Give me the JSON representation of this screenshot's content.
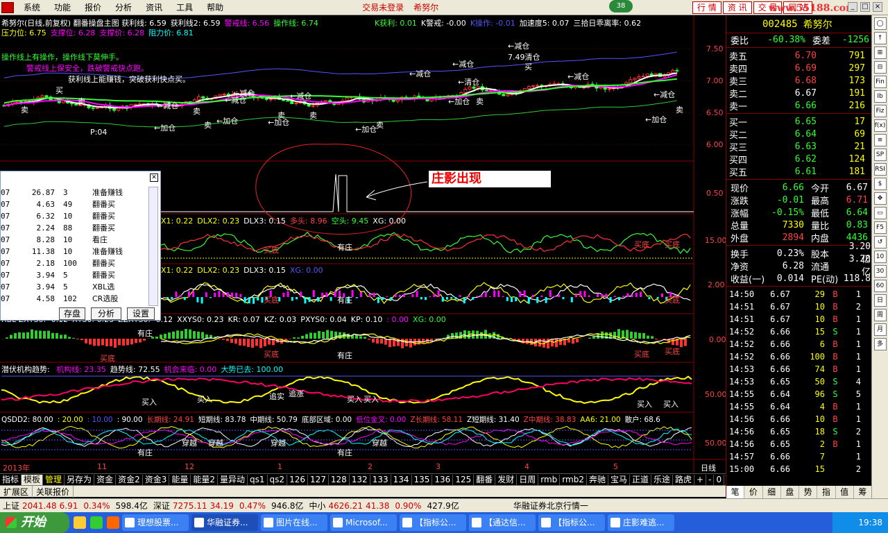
{
  "menu": {
    "items": [
      "系统",
      "功能",
      "报价",
      "分析",
      "资讯",
      "工具",
      "帮助"
    ],
    "status": "交易未登录",
    "stock_name": "希努尔",
    "badge": "38",
    "top_tabs": [
      "行 情",
      "资 讯",
      "交 易",
      "网 站"
    ],
    "site_mark": "www.55188.com",
    "window_buttons": [
      "_",
      "□",
      "×"
    ]
  },
  "chart": {
    "header_line1": {
      "prefix": "希努尔(日线,前复权) 翻番操盘主图",
      "items": [
        {
          "label": "获利线",
          "value": "6.59",
          "color": "#fff"
        },
        {
          "label": "获利线2",
          "value": "6.59",
          "color": "#fff"
        },
        {
          "label": "警戒线",
          "value": "6.56",
          "color": "#f0f"
        },
        {
          "label": "操作线",
          "value": "6.74",
          "color": "#3f3"
        }
      ],
      "right_items": [
        {
          "label": "K获利",
          "value": "0.01",
          "color": "#3f3"
        },
        {
          "label": "K警戒",
          "value": "-0.00",
          "color": "#fff"
        },
        {
          "label": "K操作",
          "value": "-0.01",
          "color": "#55f"
        },
        {
          "label": "加速度5",
          "value": "0.07",
          "color": "#fff"
        },
        {
          "label": "三拾日乖离率",
          "value": "0.62",
          "color": "#fff"
        }
      ]
    },
    "header_line2": [
      {
        "label": "压力位",
        "value": "6.75",
        "color": "#ff0"
      },
      {
        "label": "支撑位",
        "value": "6.28",
        "color": "#f0f"
      },
      {
        "label": "支撑价",
        "value": "6.28",
        "color": "#f0f"
      },
      {
        "label": "阻力价",
        "value": "6.81",
        "color": "#0ff"
      }
    ],
    "notes": [
      {
        "text": "操作线上有操作，操作线下莫伸手。",
        "color": "#3f3"
      },
      {
        "text": "警戒线上保安全，跌破警戒快点跑。",
        "color": "#f0f"
      },
      {
        "text": "获利线上能赚钱，突破获利快点买。",
        "color": "#fff"
      }
    ],
    "price_axis": [
      "7.50",
      "7.00",
      "6.50",
      "6.00"
    ],
    "price_labels": [
      "7.49清仓",
      "P:04"
    ],
    "annotation": "庄影出现",
    "panel2_axis": "0.50",
    "panel3": {
      "items": [
        {
          "label": "X1",
          "value": "0.22",
          "color": "#ff0"
        },
        {
          "label": "DLX2",
          "value": "0.23",
          "color": "#ff0"
        },
        {
          "label": "DLX3",
          "value": "0.15",
          "color": "#fff"
        },
        {
          "label": "多头",
          "value": "8.96",
          "color": "#f44"
        },
        {
          "label": "空头",
          "value": "9.45",
          "color": "#3f3"
        },
        {
          "label": "XG",
          "value": "0.00",
          "color": "#fff"
        }
      ],
      "axis": "15.00"
    },
    "panel4": {
      "items": [
        {
          "label": "X1",
          "value": "0.22",
          "color": "#ff0"
        },
        {
          "label": "DLX2",
          "value": "0.23",
          "color": "#ff0"
        },
        {
          "label": "DLX3",
          "value": "0.15",
          "color": "#fff"
        },
        {
          "label": "XG",
          "value": "0.00",
          "color": "#55f"
        }
      ],
      "axis": "2.00"
    },
    "panel5": {
      "items": [
        {
          "label": "XBL ZXYS0",
          "value": "-0.12",
          "color": "#fff"
        },
        {
          "label": "XYS0",
          "value": "0.23",
          "color": "#fff"
        },
        {
          "label": "ZZXYS0",
          "value": "-0.12",
          "color": "#fff"
        },
        {
          "label": "XXYS0",
          "value": "0.23",
          "color": "#fff"
        },
        {
          "label": "KR",
          "value": "0.07",
          "color": "#fff"
        },
        {
          "label": "KZ",
          "value": "0.03",
          "color": "#fff"
        },
        {
          "label": "PXYS0",
          "value": "0.04",
          "color": "#fff"
        },
        {
          "label": "KP",
          "value": "0.10",
          "color": "#fff"
        },
        {
          "label": "",
          "value": "0.00",
          "color": "#f0f"
        },
        {
          "label": "XG",
          "value": "0.00",
          "color": "#3f3"
        }
      ],
      "axis": "0.00"
    },
    "panel6": {
      "items": [
        {
          "label": "潜伏机构趋势",
          "value": "",
          "color": "#fff"
        },
        {
          "label": "机构线",
          "value": "23.35",
          "color": "#f0f"
        },
        {
          "label": "趋势线",
          "value": "72.55",
          "color": "#fff"
        },
        {
          "label": "机会来临",
          "value": "0.00",
          "color": "#f0f"
        },
        {
          "label": "大势已去",
          "value": "100.00",
          "color": "#0ff"
        }
      ],
      "axis": "50.00"
    },
    "panel7": {
      "items": [
        {
          "label": "QSDD2",
          "value": "80.00",
          "color": "#fff"
        },
        {
          "label": "",
          "value": "20.00",
          "color": "#ff0"
        },
        {
          "label": "",
          "value": "10.00",
          "color": "#55f"
        },
        {
          "label": "",
          "value": "90.00",
          "color": "#fff"
        },
        {
          "label": "长期线",
          "value": "24.91",
          "color": "#f44"
        },
        {
          "label": "短期线",
          "value": "83.78",
          "color": "#fff"
        },
        {
          "label": "中期线",
          "value": "50.79",
          "color": "#fff"
        },
        {
          "label": "底部区域",
          "value": "0.00",
          "color": "#fff"
        },
        {
          "label": "低位金叉",
          "value": "0.00",
          "color": "#f0f"
        },
        {
          "label": "Z长期线",
          "value": "58.11",
          "color": "#f44"
        },
        {
          "label": "Z短期线",
          "value": "31.40",
          "color": "#fff"
        },
        {
          "label": "Z中期线",
          "value": "38.83",
          "color": "#f44"
        },
        {
          "label": "AA6",
          "value": "21.00",
          "color": "#ff0"
        },
        {
          "label": "散户",
          "value": "68.6",
          "color": "#fff"
        }
      ],
      "axis": "50.00"
    },
    "date_axis": [
      "2013年",
      "11",
      "12",
      "1",
      "2",
      "3",
      "4",
      "5"
    ],
    "period_label": "日线",
    "signals": {
      "buy": "买",
      "sell": "卖",
      "reduce": "←减仓",
      "add": "←加仓",
      "clear": "←清仓",
      "have_zhuang": "有庄",
      "buy_dip": "买底",
      "buy_in": "买入",
      "trap": "追实",
      "chase": "追涨",
      "cross": "穿越"
    }
  },
  "popup": {
    "rows": [
      {
        "a": "07",
        "b": "26.87",
        "c": "3",
        "d": "准备赚钱"
      },
      {
        "a": "07",
        "b": "4.63",
        "c": "49",
        "d": "翻番买"
      },
      {
        "a": "07",
        "b": "6.32",
        "c": "10",
        "d": "翻番买"
      },
      {
        "a": "07",
        "b": "2.24",
        "c": "88",
        "d": "翻番买"
      },
      {
        "a": "07",
        "b": "8.28",
        "c": "10",
        "d": "看庄"
      },
      {
        "a": "07",
        "b": "11.38",
        "c": "10",
        "d": "准备赚钱"
      },
      {
        "a": "07",
        "b": "2.18",
        "c": "100",
        "d": "翻番买"
      },
      {
        "a": "07",
        "b": "3.94",
        "c": "5",
        "d": "翻番买"
      },
      {
        "a": "07",
        "b": "3.94",
        "c": "5",
        "d": "XBL选"
      },
      {
        "a": "07",
        "b": "4.58",
        "c": "102",
        "d": "CR选股"
      }
    ],
    "buttons": [
      "存盘",
      "分析",
      "设置"
    ]
  },
  "quote": {
    "code": "002485",
    "name": "希努尔",
    "wb": {
      "label": "委比",
      "value": "-60.38%",
      "label2": "委差",
      "value2": "-1256"
    },
    "asks": [
      {
        "label": "卖五",
        "price": "6.70",
        "vol": "791"
      },
      {
        "label": "卖四",
        "price": "6.69",
        "vol": "297"
      },
      {
        "label": "卖三",
        "price": "6.68",
        "vol": "173"
      },
      {
        "label": "卖二",
        "price": "6.67",
        "vol": "191"
      },
      {
        "label": "卖一",
        "price": "6.66",
        "vol": "216"
      }
    ],
    "bids": [
      {
        "label": "买一",
        "price": "6.65",
        "vol": "17"
      },
      {
        "label": "买二",
        "price": "6.64",
        "vol": "69"
      },
      {
        "label": "买三",
        "price": "6.63",
        "vol": "21"
      },
      {
        "label": "买四",
        "price": "6.62",
        "vol": "124"
      },
      {
        "label": "买五",
        "price": "6.61",
        "vol": "181"
      }
    ],
    "stats": [
      {
        "l1": "现价",
        "v1": "6.66",
        "c1": "#3f3",
        "l2": "今开",
        "v2": "6.67",
        "c2": "#fff"
      },
      {
        "l1": "涨跌",
        "v1": "-0.01",
        "c1": "#3f3",
        "l2": "最高",
        "v2": "6.71",
        "c2": "#f44"
      },
      {
        "l1": "涨幅",
        "v1": "-0.15%",
        "c1": "#3f3",
        "l2": "最低",
        "v2": "6.64",
        "c2": "#3f3"
      },
      {
        "l1": "总量",
        "v1": "7330",
        "c1": "#ff0",
        "l2": "量比",
        "v2": "0.83",
        "c2": "#3f3"
      },
      {
        "l1": "外盘",
        "v1": "2894",
        "c1": "#f44",
        "l2": "内盘",
        "v2": "4436",
        "c2": "#3f3"
      }
    ],
    "stats2": [
      {
        "l1": "换手",
        "v1": "0.23%",
        "l2": "股本",
        "v2": "3.20亿"
      },
      {
        "l1": "净资",
        "v1": "6.28",
        "l2": "流通",
        "v2": "3.20亿"
      },
      {
        "l1": "收益(一)",
        "v1": "0.014",
        "l2": "PE(动)",
        "v2": "118.8"
      }
    ],
    "ticks": [
      {
        "t": "14:50",
        "p": "6.67",
        "v": "29",
        "s": "B",
        "n": "1"
      },
      {
        "t": "14:51",
        "p": "6.67",
        "v": "10",
        "s": "B",
        "n": "2"
      },
      {
        "t": "14:51",
        "p": "6.67",
        "v": "10",
        "s": "B",
        "n": "1"
      },
      {
        "t": "14:52",
        "p": "6.66",
        "v": "15",
        "s": "S",
        "n": "1"
      },
      {
        "t": "14:52",
        "p": "6.66",
        "v": "6",
        "s": "B",
        "n": "1"
      },
      {
        "t": "14:52",
        "p": "6.66",
        "v": "100",
        "s": "B",
        "n": "1"
      },
      {
        "t": "14:53",
        "p": "6.66",
        "v": "74",
        "s": "B",
        "n": "1"
      },
      {
        "t": "14:53",
        "p": "6.65",
        "v": "50",
        "s": "S",
        "n": "4"
      },
      {
        "t": "14:55",
        "p": "6.64",
        "v": "96",
        "s": "S",
        "n": "5"
      },
      {
        "t": "14:55",
        "p": "6.64",
        "v": "4",
        "s": "B",
        "n": "1"
      },
      {
        "t": "14:56",
        "p": "6.66",
        "v": "10",
        "s": "B",
        "n": "1"
      },
      {
        "t": "14:56",
        "p": "6.65",
        "v": "18",
        "s": "S",
        "n": "2"
      },
      {
        "t": "14:56",
        "p": "6.65",
        "v": "2",
        "s": "B",
        "n": "1"
      },
      {
        "t": "14:57",
        "p": "6.66",
        "v": "7",
        "s": "",
        "n": "1"
      },
      {
        "t": "15:00",
        "p": "6.66",
        "v": "15",
        "s": "",
        "n": "2"
      }
    ],
    "bottom_tabs": [
      "笔",
      "价",
      "细",
      "盘",
      "势",
      "指",
      "值",
      "筹"
    ]
  },
  "toolstrip": [
    "◯",
    "↑",
    "⊞",
    "⊟",
    "Fin",
    "Ib",
    "Fiz",
    "f(x)",
    "≡",
    "SP",
    "RSI",
    "$",
    "✥",
    "▭",
    "F5",
    "↺",
    "10",
    "30",
    "60",
    "日",
    "周",
    "月",
    "多"
  ],
  "tabs": [
    {
      "label": "指标",
      "active": false
    },
    {
      "label": "模板",
      "active": true
    },
    {
      "label": "管理",
      "active": false,
      "hl": true
    },
    {
      "label": "另存为",
      "active": false
    },
    {
      "label": "资金",
      "active": false
    },
    {
      "label": "资金2",
      "active": false
    },
    {
      "label": "资金3",
      "active": false
    },
    {
      "label": "能量",
      "active": false
    },
    {
      "label": "能量2",
      "active": false
    },
    {
      "label": "量异动",
      "active": false
    },
    {
      "label": "qs1",
      "active": false
    },
    {
      "label": "qs2",
      "active": false
    },
    {
      "label": "126",
      "active": false
    },
    {
      "label": "127",
      "active": false
    },
    {
      "label": "128",
      "active": false
    },
    {
      "label": "132",
      "active": false
    },
    {
      "label": "133",
      "active": false
    },
    {
      "label": "134",
      "active": false
    },
    {
      "label": "135",
      "active": false
    },
    {
      "label": "136",
      "active": false
    },
    {
      "label": "125",
      "active": false
    },
    {
      "label": "翻番",
      "active": false
    },
    {
      "label": "发财",
      "active": false
    },
    {
      "label": "日周",
      "active": false
    },
    {
      "label": "rmb",
      "active": false
    },
    {
      "label": "rmb2",
      "active": false
    },
    {
      "label": "奔驰",
      "active": false
    },
    {
      "label": "宝马",
      "active": false
    },
    {
      "label": "正道",
      "active": false
    },
    {
      "label": "乐途",
      "active": false
    },
    {
      "label": "路虎",
      "active": false
    },
    {
      "label": "+",
      "active": false
    },
    {
      "label": "-",
      "active": false
    },
    {
      "label": "0",
      "active": false
    }
  ],
  "extbar": [
    "扩展区",
    "关联报价"
  ],
  "status": {
    "sh_label": "上证",
    "sh_val": "2041.48",
    "sh_chg": "6.91",
    "sh_pct": "0.34%",
    "sh_amt": "598.4亿",
    "sz_label": "深证",
    "sz_val": "7275.11",
    "sz_chg": "34.19",
    "sz_pct": "0.47%",
    "sz_amt": "946.8亿",
    "zx_label": "中小",
    "zx_val": "4626.21",
    "zx_chg": "41.38",
    "zx_pct": "0.90%",
    "zx_amt": "427.9亿",
    "broker": "华融证券北京行情一"
  },
  "taskbar": {
    "start": "开始",
    "tasks": [
      "理想股票...",
      "华融证券...",
      "图片在线...",
      "Microsof...",
      "【指标公...",
      "【通达信...",
      "【指标公...",
      "庄影难逃..."
    ],
    "clock": "19:38"
  }
}
